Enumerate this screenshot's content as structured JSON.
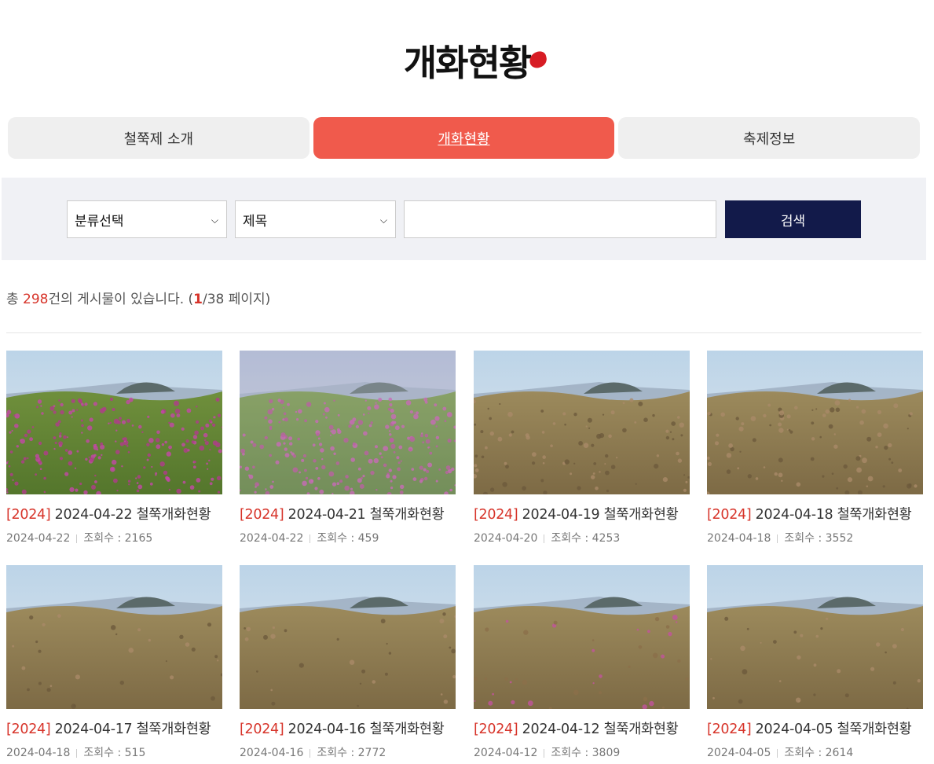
{
  "page": {
    "title": "개화현황"
  },
  "tabs": [
    {
      "label": "철쭉제 소개",
      "active": false
    },
    {
      "label": "개화현황",
      "active": true
    },
    {
      "label": "축제정보",
      "active": false
    }
  ],
  "search": {
    "category_selected": "분류선택",
    "field_selected": "제목",
    "query_value": "",
    "button_label": "검색"
  },
  "summary": {
    "prefix": "총 ",
    "total": "298",
    "middle": "건의 게시물이 있습니다. (",
    "current_page": "1",
    "pages_suffix": "/38 페이지)"
  },
  "colors": {
    "accent": "#f05a4c",
    "highlight": "#d7342a",
    "button": "#121a4a"
  },
  "posts": [
    {
      "tag": "[2024]",
      "title": "2024-04-22 철쭉개화현황",
      "date": "2024-04-22",
      "views_label": "조회수 : 2165",
      "bloom": "high"
    },
    {
      "tag": "[2024]",
      "title": "2024-04-21 철쭉개화현황",
      "date": "2024-04-22",
      "views_label": "조회수 : 459",
      "bloom": "high-fog"
    },
    {
      "tag": "[2024]",
      "title": "2024-04-19 철쭉개화현황",
      "date": "2024-04-20",
      "views_label": "조회수 : 4253",
      "bloom": "low"
    },
    {
      "tag": "[2024]",
      "title": "2024-04-18 철쭉개화현황",
      "date": "2024-04-18",
      "views_label": "조회수 : 3552",
      "bloom": "low"
    },
    {
      "tag": "[2024]",
      "title": "2024-04-17 철쭉개화현황",
      "date": "2024-04-18",
      "views_label": "조회수 : 515",
      "bloom": "none"
    },
    {
      "tag": "[2024]",
      "title": "2024-04-16 철쭉개화현황",
      "date": "2024-04-16",
      "views_label": "조회수 : 2772",
      "bloom": "none"
    },
    {
      "tag": "[2024]",
      "title": "2024-04-12 철쭉개화현황",
      "date": "2024-04-12",
      "views_label": "조회수 : 3809",
      "bloom": "few"
    },
    {
      "tag": "[2024]",
      "title": "2024-04-05 철쭉개화현황",
      "date": "2024-04-05",
      "views_label": "조회수 : 2614",
      "bloom": "none"
    }
  ]
}
